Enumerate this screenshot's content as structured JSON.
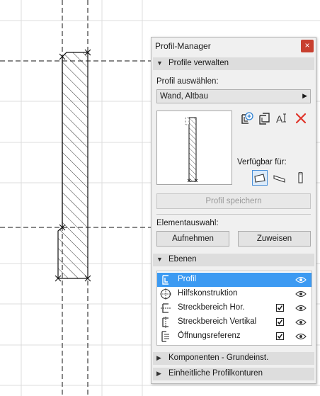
{
  "palette": {
    "title": "Profil-Manager",
    "close_glyph": "×",
    "sections": {
      "manage": "Profile verwalten",
      "layers": "Ebenen",
      "components": "Komponenten - Grundeinst.",
      "contours": "Einheitliche Profilkonturen"
    },
    "select_label": "Profil auswählen:",
    "selected_profile": "Wand, Altbau",
    "available_for_label": "Verfügbar für:",
    "save_button": "Profil speichern",
    "element_selection_label": "Elementauswahl:",
    "pick_button": "Aufnehmen",
    "assign_button": "Zuweisen",
    "icons": [
      "new-profile-icon",
      "duplicate-profile-icon",
      "rename-profile-icon",
      "delete-profile-icon",
      "wall-type-icon",
      "beam-type-icon",
      "column-type-icon"
    ],
    "layers": [
      {
        "name": "Profil",
        "selected": true,
        "has_checkbox": false,
        "checked": false
      },
      {
        "name": "Hilfskonstruktion",
        "selected": false,
        "has_checkbox": false,
        "checked": false
      },
      {
        "name": "Streckbereich Hor.",
        "selected": false,
        "has_checkbox": true,
        "checked": true
      },
      {
        "name": "Streckbereich Vertikal",
        "selected": false,
        "has_checkbox": true,
        "checked": true
      },
      {
        "name": "Öffnungsreferenz",
        "selected": false,
        "has_checkbox": true,
        "checked": true
      }
    ],
    "colors": {
      "selection": "#3c9af2",
      "close_button": "#c8402f",
      "delete_icon": "#e0362c",
      "accent_icon": "#2d7fd0"
    }
  }
}
